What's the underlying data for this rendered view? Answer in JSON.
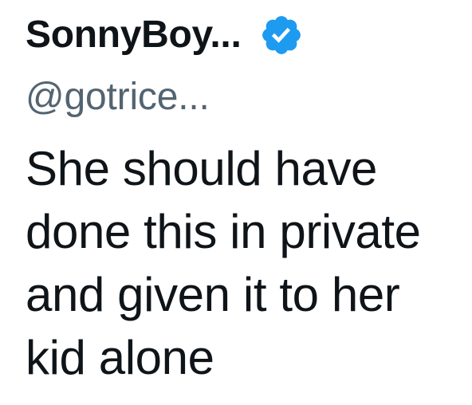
{
  "tweet": {
    "author": {
      "display_name": "SonnyBoy...",
      "handle": "@gotrice...",
      "verified": true,
      "verified_icon": "verified-badge-icon",
      "verified_color": "#1d9bf0"
    },
    "body_lines": [
      "She should have",
      "done this in private",
      "and given it to her",
      "kid alone"
    ]
  },
  "colors": {
    "text_primary": "#0f1419",
    "text_secondary": "#536471",
    "background": "#ffffff"
  }
}
